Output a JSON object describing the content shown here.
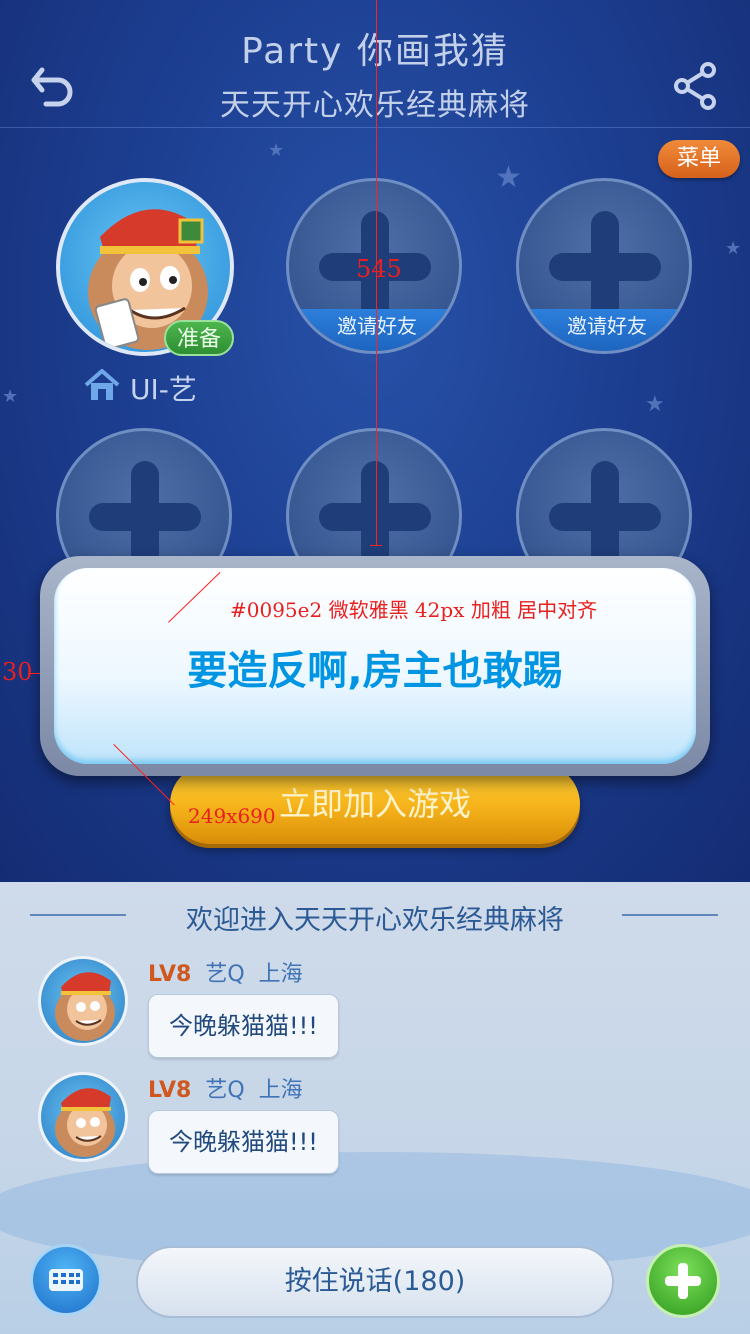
{
  "header": {
    "title": "Party 你画我猜",
    "subtitle": "天天开心欢乐经典麻将",
    "menu_label": "菜单"
  },
  "room": {
    "host_name": "UI-艺",
    "ready_label": "准备",
    "invite_label": "邀请好友",
    "join_label": "立即加入游戏"
  },
  "toast": {
    "message": "要造反啊,房主也敢踢",
    "color": "#0095e2"
  },
  "annotations": {
    "height_mark": "545",
    "side_mark": "30",
    "style_note": "#0095e2 微软雅黑 42px 加粗 居中对齐",
    "size_note": "249x690"
  },
  "chat": {
    "welcome": "欢迎进入天天开心欢乐经典麻将",
    "messages": [
      {
        "level": "LV8",
        "user": "艺Q",
        "city": "上海",
        "text": "今晚躲猫猫!!!"
      },
      {
        "level": "LV8",
        "user": "艺Q",
        "city": "上海",
        "text": "今晚躲猫猫!!!"
      }
    ]
  },
  "footer": {
    "talk_label": "按住说话(180)"
  },
  "colors": {
    "accent_blue": "#0095e2",
    "menu_orange": "#e0702a",
    "ready_green": "#3aa23c",
    "join_gold": "#f5b21a"
  },
  "icons": [
    "back-icon",
    "share-icon",
    "home-icon",
    "plus-icon",
    "keyboard-icon",
    "add-icon",
    "star-icon"
  ]
}
